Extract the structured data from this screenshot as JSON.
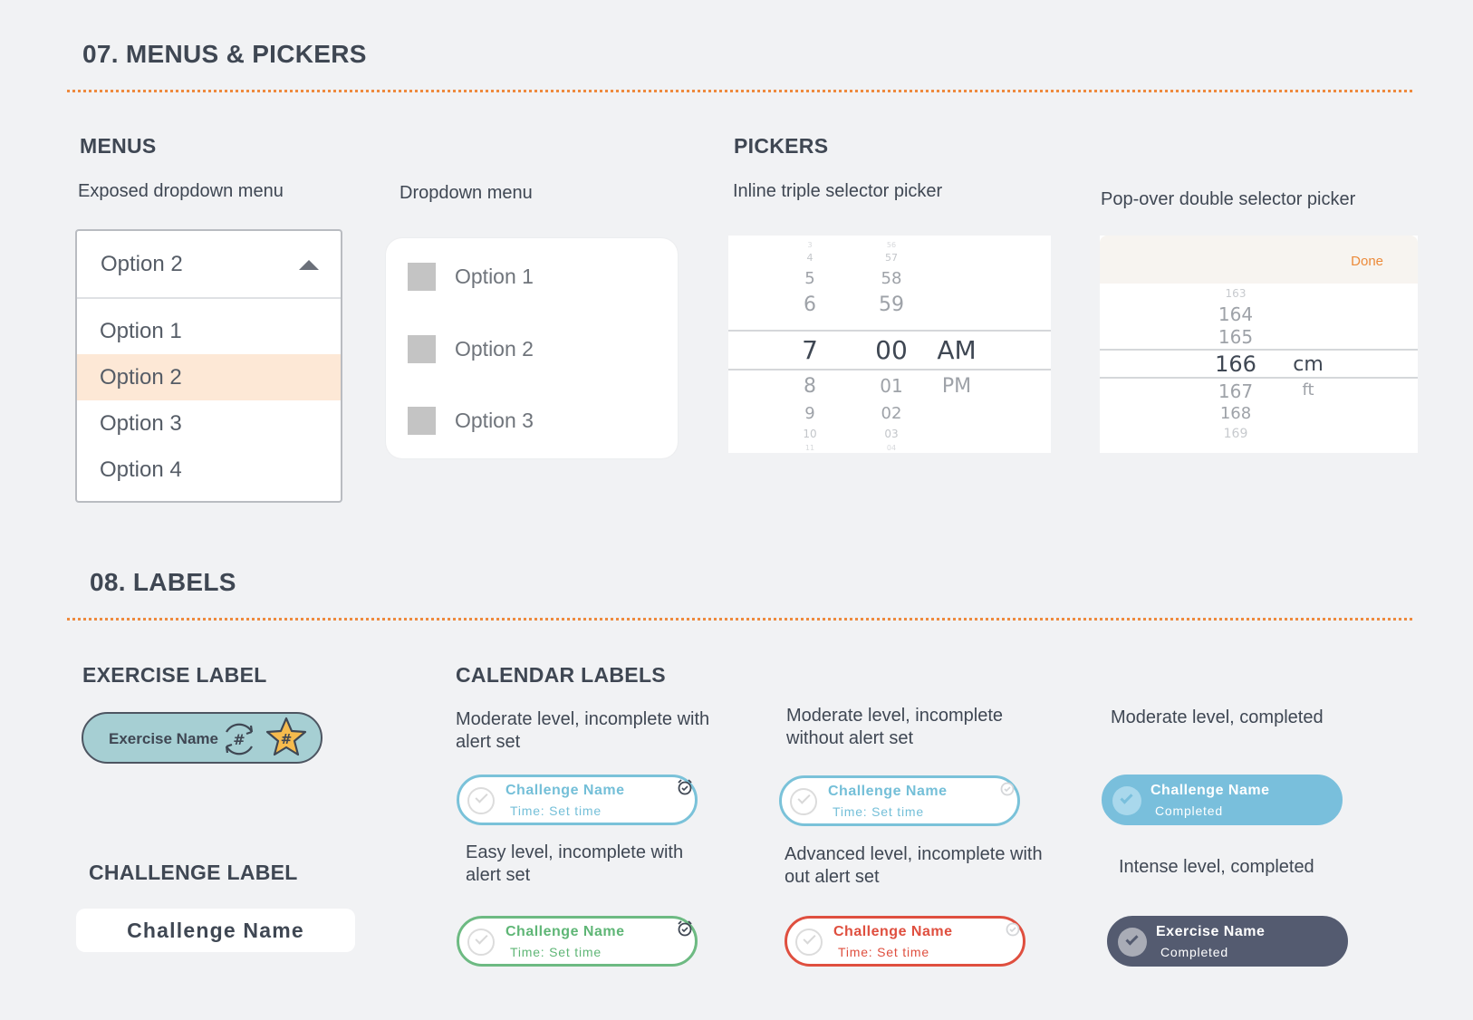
{
  "sections": {
    "menus_pickers": "07. MENUS & PICKERS",
    "labels": "08. LABELS"
  },
  "menus": {
    "title": "MENUS",
    "exposed": {
      "caption": "Exposed dropdown menu",
      "selected": "Option 2",
      "options": [
        "Option 1",
        "Option 2",
        "Option 3",
        "Option 4"
      ]
    },
    "dropdown": {
      "caption": "Dropdown menu",
      "options": [
        "Option 1",
        "Option 2",
        "Option 3"
      ]
    }
  },
  "pickers": {
    "title": "PICKERS",
    "triple": {
      "caption": "Inline triple selector picker",
      "hours": [
        "3",
        "4",
        "5",
        "6",
        "7",
        "8",
        "9",
        "10",
        "11"
      ],
      "minutes": [
        "56",
        "57",
        "58",
        "59",
        "00",
        "01",
        "02",
        "03",
        "04"
      ],
      "periods": [
        "AM",
        "PM"
      ]
    },
    "double": {
      "caption": "Pop-over double selector picker",
      "done": "Done",
      "values": [
        "163",
        "164",
        "165",
        "166",
        "167",
        "168",
        "169"
      ],
      "units": [
        "cm",
        "ft"
      ]
    }
  },
  "labels": {
    "exercise": {
      "title": "EXERCISE LABEL",
      "name": "Exercise Name",
      "colors": {
        "fill": "#a6cfd3",
        "star": "#f6bb4d"
      },
      "icons": [
        "repeat-hash-icon",
        "star-hash-icon"
      ]
    },
    "challenge": {
      "title": "CHALLENGE LABEL",
      "name": "Challenge Name"
    },
    "calendar": {
      "title": "CALENDAR LABELS",
      "items": [
        {
          "caption": "Moderate level, incomplete with alert set",
          "name": "Challenge Name",
          "sub": "Time: Set time"
        },
        {
          "caption": "Moderate level, incomplete without alert set",
          "name": "Challenge Name",
          "sub": "Time: Set time"
        },
        {
          "caption": "Moderate level, completed",
          "name": "Challenge Name",
          "sub": "Completed"
        },
        {
          "caption": "Easy level, incomplete with alert set",
          "name": "Challenge Name",
          "sub": "Time: Set time"
        },
        {
          "caption": "Advanced level, incomplete with out alert set",
          "name": "Challenge Name",
          "sub": "Time: Set time"
        },
        {
          "caption": "Intense level, completed",
          "name": "Exercise Name",
          "sub": "Completed"
        }
      ],
      "colors": {
        "moderate": "#7ac2d9",
        "easy": "#6dba82",
        "advanced": "#df4f3f",
        "intense": "#545b70"
      }
    }
  }
}
